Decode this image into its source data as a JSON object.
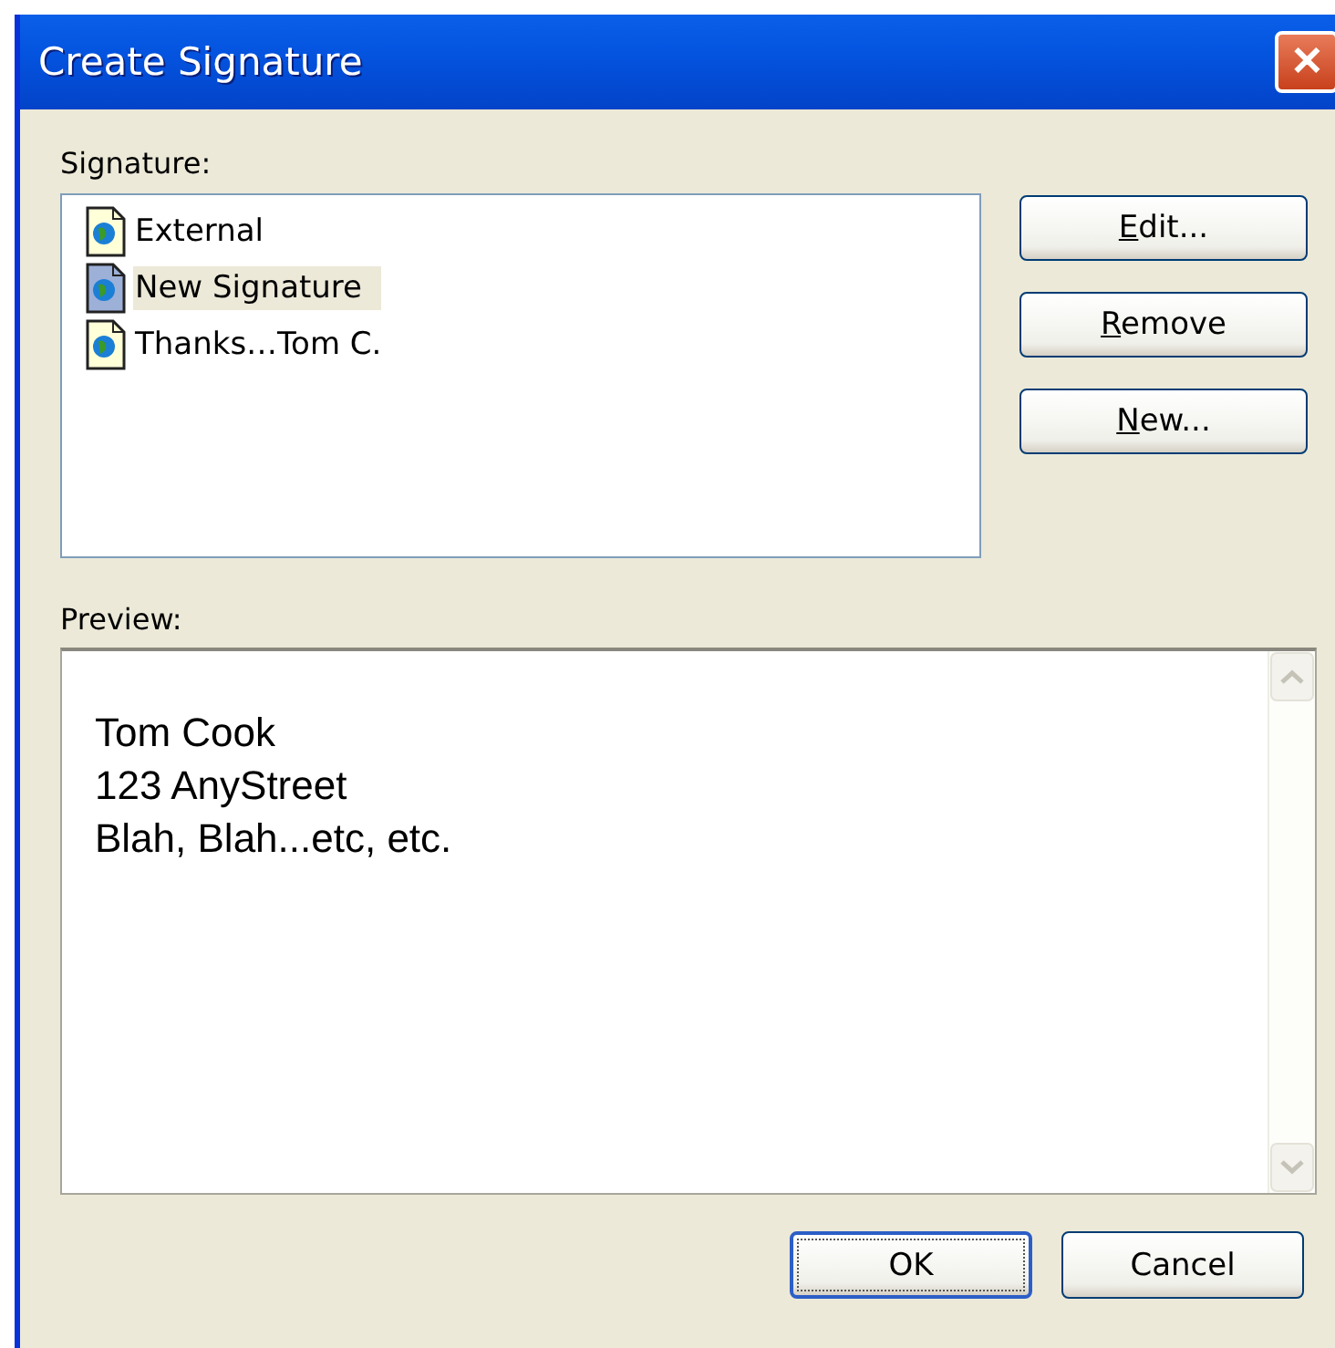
{
  "window": {
    "title": "Create Signature",
    "close": "✕"
  },
  "signature_label": "Signature:",
  "signatures": [
    {
      "label": "External",
      "selected": false
    },
    {
      "label": "New Signature",
      "selected": true
    },
    {
      "label": "Thanks…Tom C.",
      "selected": false
    }
  ],
  "side_buttons": [
    {
      "key": "E",
      "rest": "dit..."
    },
    {
      "key": "R",
      "rest": "emove"
    },
    {
      "key": "N",
      "rest": "ew..."
    }
  ],
  "preview_label": "Preview:",
  "preview_lines": [
    "Tom Cook",
    "123 AnyStreet",
    "Blah, Blah...etc, etc."
  ],
  "footer_buttons": [
    {
      "label": "OK",
      "default": true
    },
    {
      "label": "Cancel",
      "default": false
    }
  ]
}
